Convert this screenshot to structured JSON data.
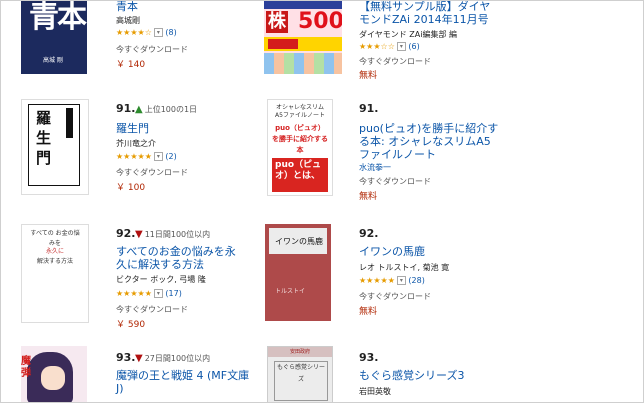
{
  "books": [
    {
      "id": "aohon",
      "title": "青本",
      "author": "高城剛",
      "stars": 3.5,
      "star_text": "★★★★☆",
      "reviews": "(8)",
      "download": "今すぐダウンロード",
      "price": "￥ 140",
      "cover": {
        "big": "青本",
        "small": "高城 剛"
      }
    },
    {
      "id": "zai",
      "title": "【無料サンプル版】ダイヤモンドZAi 2014年11月号",
      "author": "ダイヤモンド ZAi編集部 編",
      "star_text": "★★★☆☆",
      "reviews": "(6)",
      "download": "今すぐダウンロード",
      "price": "無料",
      "cover": {
        "kabu": "株",
        "num": "500"
      }
    },
    {
      "id": "rashomon",
      "rank": "91.",
      "movement": "上位100の1日",
      "title": "羅生門",
      "author": "芥川竜之介",
      "star_text": "★★★★★",
      "reviews": "(2)",
      "download": "今すぐダウンロード",
      "price": "￥ 100",
      "cover": {
        "text": "羅生門"
      }
    },
    {
      "id": "puo",
      "rank": "91.",
      "title": "puo(ピュオ)を勝手に紹介する本: オシャレなスリムA5ファイルノート",
      "author": "水流拳一",
      "download": "今すぐダウンロード",
      "price": "無料",
      "cover": {
        "top": "オシャレなスリムA5ファイルノート",
        "mid": "puo（ピュオ）を勝手に紹介する本",
        "bottom": "puo（ピュオ）とは、"
      }
    },
    {
      "id": "okane",
      "rank": "92.",
      "movement": "11日間100位以内",
      "title": "すべてのお金の悩みを永久に解決する方法",
      "author": "ビクター ボック, 弓場 隆",
      "star_text": "★★★★★",
      "reviews": "(17)",
      "download": "今すぐダウンロード",
      "price": "￥ 590",
      "cover": {
        "l1": "すべての お金の悩みを",
        "l2": "永久に",
        "l3": "解決する方法"
      }
    },
    {
      "id": "iwan",
      "rank": "92.",
      "title": "イワンの馬鹿",
      "author": "レオ トルストイ, 菊池 寛",
      "star_text": "★★★★★",
      "reviews": "(28)",
      "download": "今すぐダウンロード",
      "price": "無料",
      "cover": {
        "name": "イワンの馬鹿",
        "author": "トルストイ"
      }
    },
    {
      "id": "maou",
      "rank": "93.",
      "movement": "27日間100位以内",
      "title": "魔弾の王と戦姫 4 (MF文庫J)"
    },
    {
      "id": "mogura",
      "rank": "93.",
      "title": "もぐら感覚シリーズ3",
      "author": "岩田英敬",
      "cover": {
        "header": "安田政府",
        "text": "もぐら感覚シリーズ"
      }
    }
  ],
  "colors": {
    "link": "#0b55a8",
    "price": "#b12704",
    "star": "#e69b00",
    "up": "#2e8b2e",
    "down": "#b01010"
  }
}
